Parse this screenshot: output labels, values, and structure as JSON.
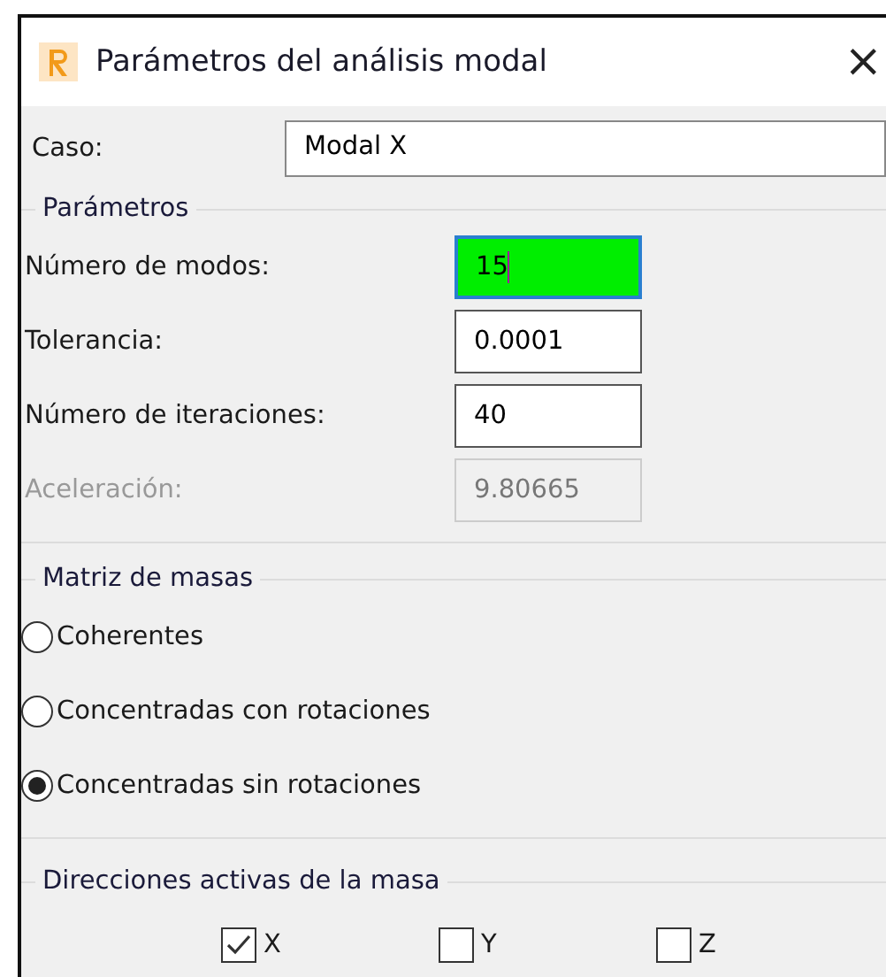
{
  "window": {
    "title": "Parámetros del análisis modal",
    "close": "×"
  },
  "case": {
    "label": "Caso:",
    "value": "Modal X"
  },
  "parameters": {
    "title": "Parámetros",
    "fields": [
      {
        "label": "Número de modos:",
        "value": "15",
        "highlighted": true,
        "disabled": false
      },
      {
        "label": "Tolerancia:",
        "value": "0.0001",
        "highlighted": false,
        "disabled": false
      },
      {
        "label": "Número de iteraciones:",
        "value": "40",
        "highlighted": false,
        "disabled": false
      },
      {
        "label": "Aceleración:",
        "value": "9.80665",
        "highlighted": false,
        "disabled": true
      }
    ]
  },
  "mass_matrix": {
    "title": "Matriz de masas",
    "options": [
      {
        "label": "Coherentes",
        "selected": false
      },
      {
        "label": "Concentradas con rotaciones",
        "selected": false
      },
      {
        "label": "Concentradas sin rotaciones",
        "selected": true
      }
    ]
  },
  "mass_directions": {
    "title": "Direcciones activas de la masa",
    "options": [
      {
        "label": "X",
        "checked": true
      },
      {
        "label": "Y",
        "checked": false
      },
      {
        "label": "Z",
        "checked": false
      }
    ]
  }
}
